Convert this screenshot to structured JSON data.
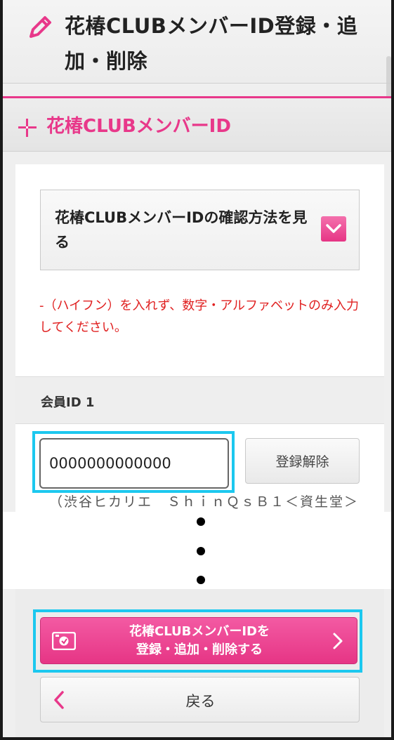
{
  "header": {
    "title": "花椿CLUBメンバーID登録・追加・削除",
    "icon": "pencil-icon"
  },
  "section": {
    "title": "花椿CLUBメンバーID",
    "icon": "plus-icon"
  },
  "accordion": {
    "label": "花椿CLUBメンバーIDの確認方法を見る",
    "icon": "chevron-down-icon"
  },
  "note": "-（ハイフン）を入れず、数字・アルファベットのみ入力してください。",
  "member": {
    "label": "会員ID 1",
    "id_value": "0000000000000",
    "unregister_label": "登録解除",
    "store": "（渋谷ヒカリエ　ＳｈｉｎＱｓＢ１＜資生堂＞"
  },
  "submit": {
    "line1": "花椿CLUBメンバーIDを",
    "line2": "登録・追加・削除する"
  },
  "back": {
    "label": "戻る"
  },
  "colors": {
    "accent": "#e8388a",
    "highlight": "#1cc8ef",
    "note": "#e02020"
  }
}
